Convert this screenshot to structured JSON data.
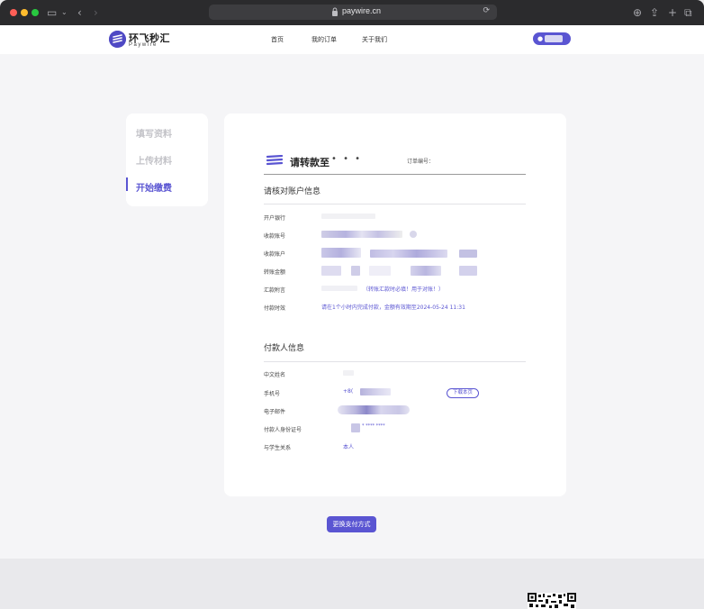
{
  "browser": {
    "url": "paywire.cn"
  },
  "header": {
    "logo_cn": "环飞秒汇",
    "logo_en": "Paywire",
    "nav": [
      "首页",
      "我的订单",
      "关于我们"
    ]
  },
  "sidebar": {
    "items": [
      {
        "label": "填写资料",
        "active": false
      },
      {
        "label": "上传材料",
        "active": false
      },
      {
        "label": "开始缴费",
        "active": true
      }
    ]
  },
  "transfer": {
    "title": "请转款至",
    "title_masked": "• • •",
    "order_label": "订单编号："
  },
  "account_section": {
    "title": "请核对账户信息",
    "rows": [
      {
        "label": "开户银行"
      },
      {
        "label": "收款账号"
      },
      {
        "label": "收款账户"
      },
      {
        "label": "转账金额"
      },
      {
        "label": "汇款附言",
        "note": "（转账汇款时必填！用于对账！）"
      },
      {
        "label": "付款时效",
        "value": "请在1个小时内完成付款，金额有效期至2024-05-24 11:31"
      }
    ]
  },
  "payer_section": {
    "title": "付款人信息",
    "rows": [
      {
        "label": "中文姓名"
      },
      {
        "label": "手机号",
        "value_prefix": "+8("
      },
      {
        "label": "电子邮件"
      },
      {
        "label": "付款人身份证号",
        "value_masked": "* **** ****"
      },
      {
        "label": "与学生关系",
        "value": "本人"
      }
    ],
    "download_button": "下载本页"
  },
  "actions": {
    "change_payment": "更换支付方式"
  },
  "colors": {
    "accent": "#5a55d2",
    "page_bg": "#f5f5f7"
  }
}
